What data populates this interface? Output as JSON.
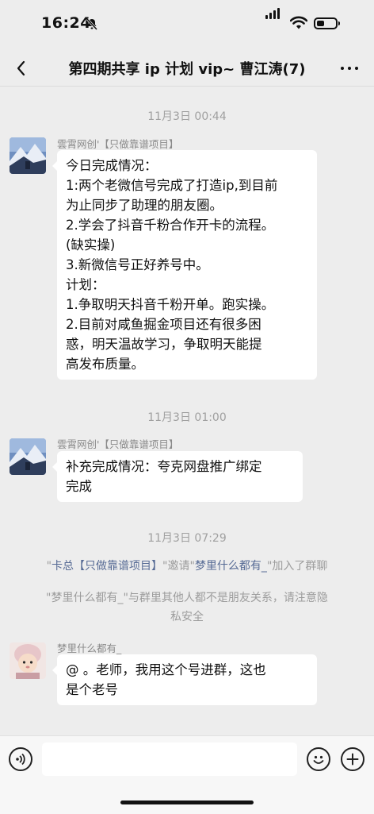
{
  "status_bar": {
    "time": "16:24"
  },
  "header": {
    "title": "第四期共享 ip 计划 vip~ 曹江涛(7)"
  },
  "messages": {
    "ts1": "11月3日 00:44",
    "sender1": "雲霄网创'【只做靠谱项目】",
    "msg1_lines": [
      "今日完成情况：",
      "1:两个老微信号完成了打造ip,到目前",
      "为止同步了助理的朋友圈。",
      "2.学会了抖音千粉合作开卡的流程。",
      "(缺实操)",
      "3.新微信号正好养号中。",
      "计划：",
      "1.争取明天抖音千粉开单。跑实操。",
      "2.目前对咸鱼掘金项目还有很多困",
      "惑，明天温故学习，争取明天能提",
      "高发布质量。"
    ],
    "ts2": "11月3日 01:00",
    "sender2": "雲霄网创'【只做靠谱项目】",
    "msg2_lines": [
      "补充完成情况：夸克网盘推广绑定",
      "完成"
    ],
    "ts3": "11月3日 07:29",
    "sys1": {
      "q1": "\"",
      "inviter": "卡总【只做靠谱项目】",
      "q2": "\"邀请\"",
      "invitee": "梦里什么都有_",
      "q3": "\"加入了群聊"
    },
    "sys2_lines": [
      "\"梦里什么都有_\"与群里其他人都不是朋友关系，请注意隐",
      "私安全"
    ],
    "sender3": "梦里什么都有_",
    "msg3_lines": [
      "@  。老师，我用这个号进群，这也",
      "是个老号"
    ]
  },
  "colors": {
    "background": "#ededed",
    "bubble": "#ffffff",
    "link": "#576b95",
    "timestamp": "#a0a0a0"
  }
}
